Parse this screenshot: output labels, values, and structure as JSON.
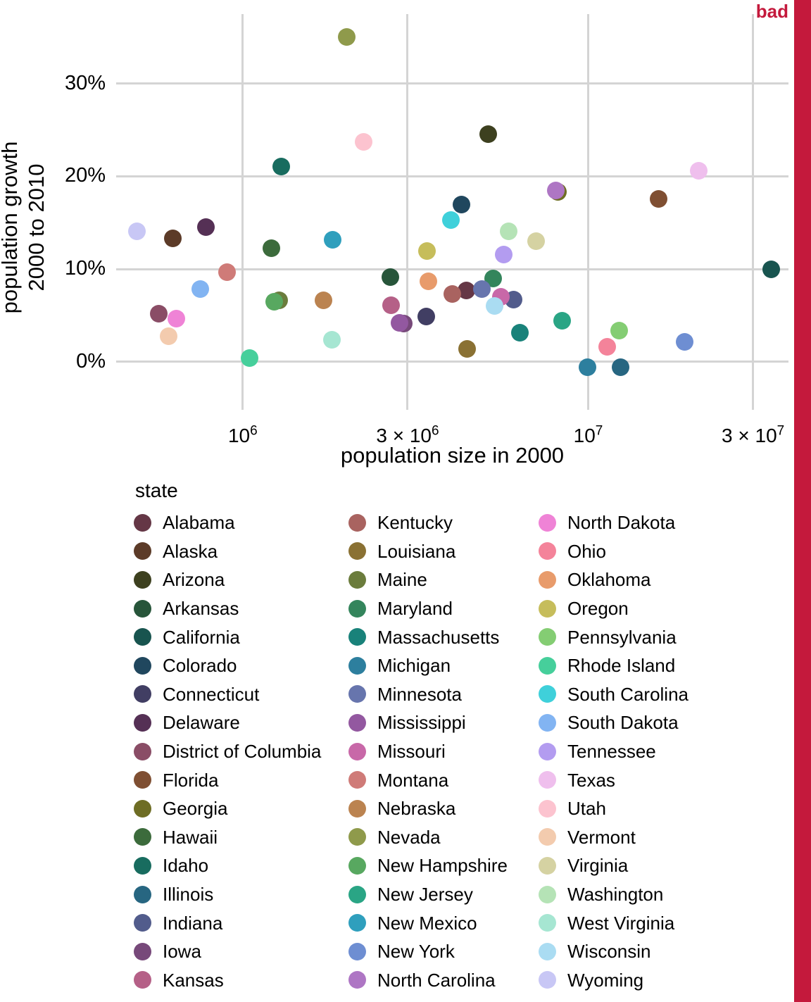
{
  "annotation": {
    "bad_label": "bad",
    "bad_color": "#c4193c"
  },
  "axes": {
    "ylabel_line1": "population growth",
    "ylabel_line2": "2000 to 2010",
    "xlabel": "population size in 2000",
    "yticks": [
      "0%",
      "10%",
      "20%",
      "30%"
    ],
    "xticks": [
      "10⁶",
      "3 × 10⁶",
      "10⁷",
      "3 × 10⁷"
    ]
  },
  "legend": {
    "title": "state",
    "columns": [
      [
        {
          "label": "Alabama",
          "color": "#653746"
        },
        {
          "label": "Alaska",
          "color": "#5c3b28"
        },
        {
          "label": "Arizona",
          "color": "#3d401f"
        },
        {
          "label": "Arkansas",
          "color": "#27553a"
        },
        {
          "label": "California",
          "color": "#18544f"
        },
        {
          "label": "Colorado",
          "color": "#20475e"
        },
        {
          "label": "Connecticut",
          "color": "#413e63"
        },
        {
          "label": "Delaware",
          "color": "#553055"
        },
        {
          "label": "District of Columbia",
          "color": "#8a4d66"
        },
        {
          "label": "Florida",
          "color": "#7f4f32"
        },
        {
          "label": "Georgia",
          "color": "#6e6d24"
        },
        {
          "label": "Hawaii",
          "color": "#3c6b3c"
        },
        {
          "label": "Idaho",
          "color": "#186c5f"
        },
        {
          "label": "Illinois",
          "color": "#276681"
        },
        {
          "label": "Indiana",
          "color": "#525c8c"
        },
        {
          "label": "Iowa",
          "color": "#77497a"
        },
        {
          "label": "Kansas",
          "color": "#b56087"
        }
      ],
      [
        {
          "label": "Kentucky",
          "color": "#a96360"
        },
        {
          "label": "Louisiana",
          "color": "#8a7133"
        },
        {
          "label": "Maine",
          "color": "#6b7c3c"
        },
        {
          "label": "Maryland",
          "color": "#34855c"
        },
        {
          "label": "Massachusetts",
          "color": "#19827a"
        },
        {
          "label": "Michigan",
          "color": "#2d7f9e"
        },
        {
          "label": "Minnesota",
          "color": "#6775ad"
        },
        {
          "label": "Mississippi",
          "color": "#9358a0"
        },
        {
          "label": "Missouri",
          "color": "#c868a8"
        },
        {
          "label": "Montana",
          "color": "#cf7b78"
        },
        {
          "label": "Nebraska",
          "color": "#bb8350"
        },
        {
          "label": "Nevada",
          "color": "#8f9a4b"
        },
        {
          "label": "New Hampshire",
          "color": "#58a860"
        },
        {
          "label": "New Jersey",
          "color": "#2aa585"
        },
        {
          "label": "New Mexico",
          "color": "#2f9fbd"
        },
        {
          "label": "New York",
          "color": "#6e8ed2"
        },
        {
          "label": "North Carolina",
          "color": "#ae76c4"
        }
      ],
      [
        {
          "label": "North Dakota",
          "color": "#ef83d6"
        },
        {
          "label": "Ohio",
          "color": "#f4839a"
        },
        {
          "label": "Oklahoma",
          "color": "#e89b6b"
        },
        {
          "label": "Oregon",
          "color": "#c6bd5b"
        },
        {
          "label": "Pennsylvania",
          "color": "#84cd73"
        },
        {
          "label": "Rhode Island",
          "color": "#46cf9b"
        },
        {
          "label": "South Carolina",
          "color": "#3fd0da"
        },
        {
          "label": "South Dakota",
          "color": "#82b4f2"
        },
        {
          "label": "Tennessee",
          "color": "#b39cf0"
        },
        {
          "label": "Texas",
          "color": "#efbfed"
        },
        {
          "label": "Utah",
          "color": "#fcc3cf"
        },
        {
          "label": "Vermont",
          "color": "#f3cbae"
        },
        {
          "label": "Virginia",
          "color": "#d5d2a2"
        },
        {
          "label": "Washington",
          "color": "#b5e3b6"
        },
        {
          "label": "West Virginia",
          "color": "#a6e6d2"
        },
        {
          "label": "Wisconsin",
          "color": "#aadcf2"
        },
        {
          "label": "Wyoming",
          "color": "#c8c7f5"
        }
      ]
    ]
  },
  "chart_data": {
    "type": "scatter",
    "title": "",
    "xlabel": "population size in 2000",
    "ylabel": "population growth 2000 to 2010",
    "xscale": "log",
    "xlim": [
      430000,
      38000000
    ],
    "ylim": [
      -0.035,
      0.375
    ],
    "xtick_values": [
      1000000,
      3000000,
      10000000,
      30000000
    ],
    "xtick_labels": [
      "10^6",
      "3 x 10^6",
      "10^7",
      "3 x 10^7"
    ],
    "ytick_values": [
      0,
      0.1,
      0.2,
      0.3
    ],
    "ytick_labels": [
      "0%",
      "10%",
      "20%",
      "30%"
    ],
    "grid": true,
    "legend_position": "bottom",
    "color_key": "state",
    "points": [
      {
        "state": "Alabama",
        "pop2000": 4447100,
        "growth": 0.0771,
        "color": "#653746"
      },
      {
        "state": "Alaska",
        "pop2000": 626932,
        "growth": 0.1332,
        "color": "#5c3b28"
      },
      {
        "state": "Arizona",
        "pop2000": 5130632,
        "growth": 0.2456,
        "color": "#3d401f"
      },
      {
        "state": "Arkansas",
        "pop2000": 2673400,
        "growth": 0.0914,
        "color": "#27553a"
      },
      {
        "state": "California",
        "pop2000": 33871648,
        "growth": 0.0999,
        "color": "#18544f"
      },
      {
        "state": "Colorado",
        "pop2000": 4301261,
        "growth": 0.1693,
        "color": "#20475e"
      },
      {
        "state": "Connecticut",
        "pop2000": 3405565,
        "growth": 0.049,
        "color": "#413e63"
      },
      {
        "state": "Delaware",
        "pop2000": 783600,
        "growth": 0.1453,
        "color": "#553055"
      },
      {
        "state": "District of Columbia",
        "pop2000": 572059,
        "growth": 0.052,
        "color": "#8a4d66"
      },
      {
        "state": "Florida",
        "pop2000": 15982378,
        "growth": 0.1758,
        "color": "#7f4f32"
      },
      {
        "state": "Georgia",
        "pop2000": 8186453,
        "growth": 0.1832,
        "color": "#6e6d24"
      },
      {
        "state": "Hawaii",
        "pop2000": 1211537,
        "growth": 0.1222,
        "color": "#3c6b3c"
      },
      {
        "state": "Idaho",
        "pop2000": 1293953,
        "growth": 0.211,
        "color": "#186c5f"
      },
      {
        "state": "Illinois",
        "pop2000": 12419293,
        "growth": -0.0055,
        "color": "#276681"
      },
      {
        "state": "Indiana",
        "pop2000": 6080485,
        "growth": 0.0668,
        "color": "#525c8c"
      },
      {
        "state": "Iowa",
        "pop2000": 2926324,
        "growth": 0.0415,
        "color": "#77497a"
      },
      {
        "state": "Kansas",
        "pop2000": 2688418,
        "growth": 0.0608,
        "color": "#b56087"
      },
      {
        "state": "Kentucky",
        "pop2000": 4041769,
        "growth": 0.0734,
        "color": "#a96360"
      },
      {
        "state": "Louisiana",
        "pop2000": 4468976,
        "growth": 0.0138,
        "color": "#8a7133"
      },
      {
        "state": "Maine",
        "pop2000": 1274923,
        "growth": 0.0666,
        "color": "#6b7c3c"
      },
      {
        "state": "Maryland",
        "pop2000": 5296486,
        "growth": 0.0902,
        "color": "#34855c"
      },
      {
        "state": "Massachusetts",
        "pop2000": 6349097,
        "growth": 0.0313,
        "color": "#19827a"
      },
      {
        "state": "Michigan",
        "pop2000": 9938444,
        "growth": -0.0059,
        "color": "#2d7f9e"
      },
      {
        "state": "Minnesota",
        "pop2000": 4919479,
        "growth": 0.0782,
        "color": "#6775ad"
      },
      {
        "state": "Mississippi",
        "pop2000": 2844658,
        "growth": 0.0421,
        "color": "#9358a0"
      },
      {
        "state": "Missouri",
        "pop2000": 5595211,
        "growth": 0.07,
        "color": "#c868a8"
      },
      {
        "state": "Montana",
        "pop2000": 902195,
        "growth": 0.0967,
        "color": "#cf7b78"
      },
      {
        "state": "Nebraska",
        "pop2000": 1711263,
        "growth": 0.0665,
        "color": "#bb8350"
      },
      {
        "state": "Nevada",
        "pop2000": 1998257,
        "growth": 0.3503,
        "color": "#8f9a4b"
      },
      {
        "state": "New Hampshire",
        "pop2000": 1235786,
        "growth": 0.0647,
        "color": "#58a860"
      },
      {
        "state": "New Jersey",
        "pop2000": 8414350,
        "growth": 0.0446,
        "color": "#2aa585"
      },
      {
        "state": "New Mexico",
        "pop2000": 1819046,
        "growth": 0.1316,
        "color": "#2f9fbd"
      },
      {
        "state": "New York",
        "pop2000": 18976457,
        "growth": 0.0212,
        "color": "#6e8ed2"
      },
      {
        "state": "North Carolina",
        "pop2000": 8049313,
        "growth": 0.185,
        "color": "#ae76c4"
      },
      {
        "state": "North Dakota",
        "pop2000": 642200,
        "growth": 0.0468,
        "color": "#ef83d6"
      },
      {
        "state": "Ohio",
        "pop2000": 11353140,
        "growth": 0.0159,
        "color": "#f4839a"
      },
      {
        "state": "Oklahoma",
        "pop2000": 3450654,
        "growth": 0.0871,
        "color": "#e89b6b"
      },
      {
        "state": "Oregon",
        "pop2000": 3421399,
        "growth": 0.1197,
        "color": "#c6bd5b"
      },
      {
        "state": "Pennsylvania",
        "pop2000": 12281054,
        "growth": 0.0339,
        "color": "#84cd73"
      },
      {
        "state": "Rhode Island",
        "pop2000": 1048319,
        "growth": 0.0041,
        "color": "#46cf9b"
      },
      {
        "state": "South Carolina",
        "pop2000": 4012012,
        "growth": 0.1532,
        "color": "#3fd0da"
      },
      {
        "state": "South Dakota",
        "pop2000": 754844,
        "growth": 0.0786,
        "color": "#82b4f2"
      },
      {
        "state": "Tennessee",
        "pop2000": 5689283,
        "growth": 0.1154,
        "color": "#b39cf0"
      },
      {
        "state": "Texas",
        "pop2000": 20851820,
        "growth": 0.2059,
        "color": "#efbfed"
      },
      {
        "state": "Utah",
        "pop2000": 2233169,
        "growth": 0.237,
        "color": "#fcc3cf"
      },
      {
        "state": "Vermont",
        "pop2000": 608827,
        "growth": 0.0278,
        "color": "#f3cbae"
      },
      {
        "state": "Virginia",
        "pop2000": 7078515,
        "growth": 0.1303,
        "color": "#d5d2a2"
      },
      {
        "state": "Washington",
        "pop2000": 5894121,
        "growth": 0.1406,
        "color": "#b5e3b6"
      },
      {
        "state": "West Virginia",
        "pop2000": 1808344,
        "growth": 0.0241,
        "color": "#a6e6d2"
      },
      {
        "state": "Wisconsin",
        "pop2000": 5363675,
        "growth": 0.0601,
        "color": "#aadcf2"
      },
      {
        "state": "Wyoming",
        "pop2000": 493782,
        "growth": 0.1408,
        "color": "#c8c7f5"
      }
    ]
  }
}
